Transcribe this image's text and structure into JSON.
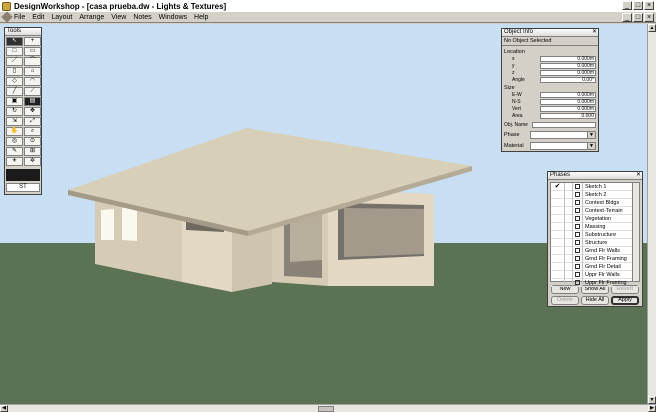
{
  "window": {
    "title": "DesignWorkshop - [casa prueba.dw - Lights & Textures]"
  },
  "menu": [
    "File",
    "Edit",
    "Layout",
    "Arrange",
    "View",
    "Notes",
    "Windows",
    "Help"
  ],
  "window_buttons": [
    "_",
    "□",
    "×"
  ],
  "tools_palette": {
    "title": "Tools",
    "tools": [
      {
        "glyph": "↖",
        "name": "select-arrow",
        "selected": true
      },
      {
        "glyph": "+",
        "name": "crosshair"
      },
      {
        "glyph": "□",
        "name": "rectangle"
      },
      {
        "glyph": "▭",
        "name": "block"
      },
      {
        "glyph": "／",
        "name": "line"
      },
      {
        "glyph": "⌒",
        "name": "arc"
      },
      {
        "glyph": "▯",
        "name": "wall"
      },
      {
        "glyph": "⌂",
        "name": "roof"
      },
      {
        "glyph": "◇",
        "name": "polygon"
      },
      {
        "glyph": "◠",
        "name": "dome"
      },
      {
        "glyph": "╱",
        "name": "pencil"
      },
      {
        "glyph": "⟋",
        "name": "eraser"
      },
      {
        "glyph": "▣",
        "name": "opening"
      },
      {
        "glyph": "▤",
        "name": "stair",
        "dark": true
      },
      {
        "glyph": "↻",
        "name": "rotate"
      },
      {
        "glyph": "✥",
        "name": "move"
      },
      {
        "glyph": "⇲",
        "name": "scale"
      },
      {
        "glyph": "⤢",
        "name": "stretch"
      },
      {
        "glyph": "✋",
        "name": "pan"
      },
      {
        "glyph": "⌕",
        "name": "zoom"
      },
      {
        "glyph": "◎",
        "name": "eye"
      },
      {
        "glyph": "⊙",
        "name": "camera"
      },
      {
        "glyph": "✎",
        "name": "note"
      },
      {
        "glyph": "⊞",
        "name": "grid"
      },
      {
        "glyph": "☀",
        "name": "sun"
      },
      {
        "glyph": "✲",
        "name": "light"
      }
    ],
    "footer": "ST"
  },
  "object_info": {
    "title": "Object Info",
    "header": "No Object Selected",
    "location_label": "Location",
    "location": [
      {
        "label": "x",
        "value": "0.000m"
      },
      {
        "label": "y",
        "value": "0.000m"
      },
      {
        "label": "z",
        "value": "0.000m"
      },
      {
        "label": "Angle",
        "value": "0.00°"
      }
    ],
    "size_label": "Size",
    "size": [
      {
        "label": "E-W",
        "value": "0.000m"
      },
      {
        "label": "N-S",
        "value": "0.000m"
      },
      {
        "label": "Vert",
        "value": "0.000m"
      },
      {
        "label": "Area",
        "value": "0.000"
      }
    ],
    "obj_name_label": "Obj. Name",
    "phase_label": "Phase",
    "material_label": "Material"
  },
  "phases_palette": {
    "title": "Phases",
    "items": [
      {
        "name": "Sketch 1",
        "checked": true
      },
      {
        "name": "Sketch 2"
      },
      {
        "name": "Context Bldgs"
      },
      {
        "name": "Context-Terrain"
      },
      {
        "name": "Vegetation"
      },
      {
        "name": "Massing"
      },
      {
        "name": "Substructure"
      },
      {
        "name": "Structure"
      },
      {
        "name": "Grnd Flr Walls"
      },
      {
        "name": "Grnd Flr Framing"
      },
      {
        "name": "Grnd Flr Detail"
      },
      {
        "name": "Uppr Flr Walls"
      },
      {
        "name": "Uppr Flr Framing"
      }
    ],
    "buttons": [
      {
        "label": "New",
        "state": "normal"
      },
      {
        "label": "Show All",
        "state": "normal"
      },
      {
        "label": "Revert",
        "state": "disabled"
      },
      {
        "label": "Delete",
        "state": "disabled"
      },
      {
        "label": "Hide All",
        "state": "normal"
      },
      {
        "label": "Apply",
        "state": "default"
      }
    ]
  },
  "scene": {
    "sky_color": "#c8def2",
    "ground_color": "#5c7254",
    "wall_color": "#e2d8c4",
    "roof_color": "#d8cfb9"
  }
}
